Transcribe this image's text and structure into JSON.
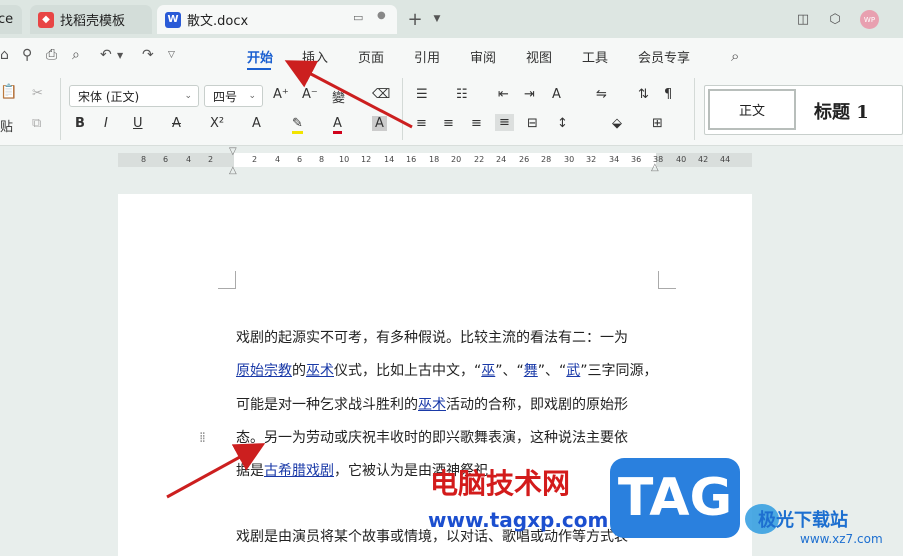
{
  "tabs": [
    {
      "label": "ce"
    },
    {
      "label": "找稻壳模板",
      "icon": "dk"
    },
    {
      "label": "散文.docx",
      "icon": "W"
    }
  ],
  "titlebar": {
    "new_tab": "+",
    "avatar": "WP"
  },
  "menu": {
    "items": [
      "开始",
      "插入",
      "页面",
      "引用",
      "审阅",
      "视图",
      "工具",
      "会员专享"
    ],
    "active": "开始"
  },
  "ribbon": {
    "font_name": "宋体 (正文)",
    "font_size": "四号",
    "paste_label": "贴",
    "styles": {
      "normal": "正文",
      "heading": "标题 1"
    }
  },
  "ruler": {
    "left_ticks": [
      "8",
      "6",
      "4",
      "2"
    ],
    "right_ticks": [
      "2",
      "4",
      "6",
      "8",
      "10",
      "12",
      "14",
      "16",
      "18",
      "20",
      "22",
      "24",
      "26",
      "28",
      "30",
      "32",
      "34",
      "36",
      "38"
    ],
    "margin_ticks": [
      "40",
      "42",
      "44"
    ]
  },
  "document": {
    "lines": [
      {
        "parts": [
          {
            "t": "戏剧的起源实不可考，有多种假说。比较主流的看法有二：一为"
          }
        ]
      },
      {
        "parts": [
          {
            "t": "原始宗教",
            "link": true
          },
          {
            "t": "的"
          },
          {
            "t": "巫术",
            "link": true
          },
          {
            "t": "仪式，比如上古中文，“"
          },
          {
            "t": "巫",
            "link": true
          },
          {
            "t": "”、“"
          },
          {
            "t": "舞",
            "link": true
          },
          {
            "t": "”、“"
          },
          {
            "t": "武",
            "link": true
          },
          {
            "t": "”三字同源，"
          }
        ]
      },
      {
        "parts": [
          {
            "t": "可能是对一种乞求战斗胜利的"
          },
          {
            "t": "巫术",
            "link": true
          },
          {
            "t": "活动的合称，即戏剧的原始形"
          }
        ]
      },
      {
        "parts": [
          {
            "t": "态。另一为劳动或庆祝丰收时的即兴歌舞表演，这种说法主要依"
          }
        ]
      },
      {
        "parts": [
          {
            "t": "据是"
          },
          {
            "t": "古希腊戏剧",
            "link": true
          },
          {
            "t": "，它被认为是由酒神祭祀"
          }
        ]
      },
      {
        "parts": [
          {
            "t": ""
          }
        ]
      },
      {
        "parts": [
          {
            "t": "戏剧是由演员将某个故事或情境，以对话、歌唱或动作等方式表"
          }
        ]
      }
    ]
  },
  "watermark": {
    "site_name": "电脑技术网",
    "site_url": "www.tagxp.com",
    "tag": "TAG",
    "brand2": "极光下载站",
    "brand2_url": "www.xz7.com"
  },
  "colors": {
    "accent": "#1a5fd0",
    "annotation_arrow": "#cc1f1f",
    "link": "#1a3aa8"
  }
}
